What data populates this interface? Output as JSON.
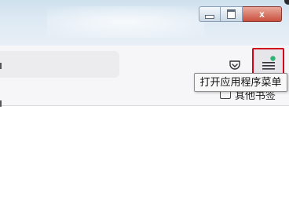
{
  "window": {
    "minimize_icon": "minimize-icon",
    "maximize_icon": "maximize-icon",
    "close_glyph": "x"
  },
  "toolbar": {
    "pocket_icon": "pocket-icon",
    "menu_button_icon": "hamburger-menu-icon",
    "menu_highlight_color": "#d0021b",
    "update_badge_color": "#2bb673"
  },
  "tooltip": {
    "text": "打开应用程序菜单"
  },
  "bookmarks": {
    "other_bookmarks_label": "其他书签"
  }
}
